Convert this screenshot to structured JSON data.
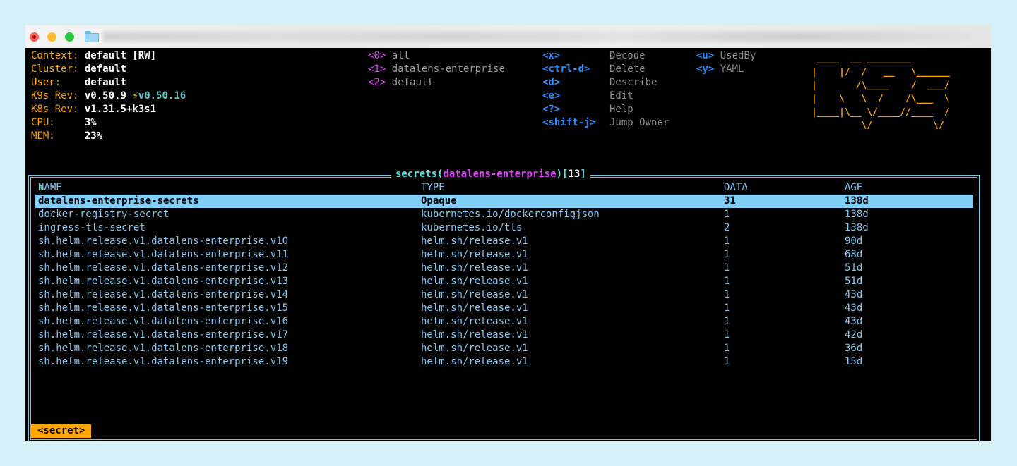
{
  "window": {
    "controls": [
      "close",
      "minimize",
      "zoom"
    ],
    "title_icon": "folder-icon"
  },
  "info": {
    "context": {
      "label": "Context:",
      "value": "default [RW]"
    },
    "cluster": {
      "label": "Cluster:",
      "value": "default"
    },
    "user": {
      "label": "User:",
      "value": "default"
    },
    "k9s_rev": {
      "label": "K9s Rev:",
      "value": "v0.50.9",
      "bolt": "⚡",
      "latest": "v0.50.16"
    },
    "k8s_rev": {
      "label": "K8s Rev:",
      "value": "v1.31.5+k3s1"
    },
    "cpu": {
      "label": "CPU:",
      "value": "3%"
    },
    "mem": {
      "label": "MEM:",
      "value": "23%"
    }
  },
  "namespaces": [
    {
      "key": "<0>",
      "name": "all"
    },
    {
      "key": "<1>",
      "name": "datalens-enterprise"
    },
    {
      "key": "<2>",
      "name": "default"
    }
  ],
  "hotkeys_col1": [
    {
      "key": "<x>",
      "action": "Decode"
    },
    {
      "key": "<ctrl-d>",
      "action": "Delete"
    },
    {
      "key": "<d>",
      "action": "Describe"
    },
    {
      "key": "<e>",
      "action": "Edit"
    },
    {
      "key": "<?>",
      "action": "Help"
    },
    {
      "key": "<shift-j>",
      "action": "Jump Owner"
    }
  ],
  "hotkeys_col2": [
    {
      "key": "<u>",
      "action": "UsedBy"
    },
    {
      "key": "<y>",
      "action": "YAML"
    }
  ],
  "logo_lines": [
    " ____  __ ________        ",
    "|    |/  /   __   \\______ ",
    "|       /\\____    /  ___/ ",
    "|    \\   \\  /    /\\___  \\ ",
    "|____|\\__ \\/____//____  / ",
    "         \\/           \\/  "
  ],
  "table": {
    "title": {
      "resource": "secrets",
      "open": "(",
      "namespace": "datalens-enterprise",
      "close": ")",
      "count_open": "[",
      "count": "13",
      "count_close": "]"
    },
    "headers": {
      "name": "NAME",
      "sort_arrow": "↑",
      "type": "TYPE",
      "data": "DATA",
      "age": "AGE"
    },
    "rows": [
      {
        "name": "datalens-enterprise-secrets",
        "type": "Opaque",
        "data": "31",
        "age": "138d"
      },
      {
        "name": "docker-registry-secret",
        "type": "kubernetes.io/dockerconfigjson",
        "data": "1",
        "age": "138d"
      },
      {
        "name": "ingress-tls-secret",
        "type": "kubernetes.io/tls",
        "data": "2",
        "age": "138d"
      },
      {
        "name": "sh.helm.release.v1.datalens-enterprise.v10",
        "type": "helm.sh/release.v1",
        "data": "1",
        "age": "90d"
      },
      {
        "name": "sh.helm.release.v1.datalens-enterprise.v11",
        "type": "helm.sh/release.v1",
        "data": "1",
        "age": "68d"
      },
      {
        "name": "sh.helm.release.v1.datalens-enterprise.v12",
        "type": "helm.sh/release.v1",
        "data": "1",
        "age": "51d"
      },
      {
        "name": "sh.helm.release.v1.datalens-enterprise.v13",
        "type": "helm.sh/release.v1",
        "data": "1",
        "age": "51d"
      },
      {
        "name": "sh.helm.release.v1.datalens-enterprise.v14",
        "type": "helm.sh/release.v1",
        "data": "1",
        "age": "43d"
      },
      {
        "name": "sh.helm.release.v1.datalens-enterprise.v15",
        "type": "helm.sh/release.v1",
        "data": "1",
        "age": "43d"
      },
      {
        "name": "sh.helm.release.v1.datalens-enterprise.v16",
        "type": "helm.sh/release.v1",
        "data": "1",
        "age": "43d"
      },
      {
        "name": "sh.helm.release.v1.datalens-enterprise.v17",
        "type": "helm.sh/release.v1",
        "data": "1",
        "age": "42d"
      },
      {
        "name": "sh.helm.release.v1.datalens-enterprise.v18",
        "type": "helm.sh/release.v1",
        "data": "1",
        "age": "36d"
      },
      {
        "name": "sh.helm.release.v1.datalens-enterprise.v19",
        "type": "helm.sh/release.v1",
        "data": "1",
        "age": "15d"
      }
    ]
  },
  "crumb": "<secret>"
}
